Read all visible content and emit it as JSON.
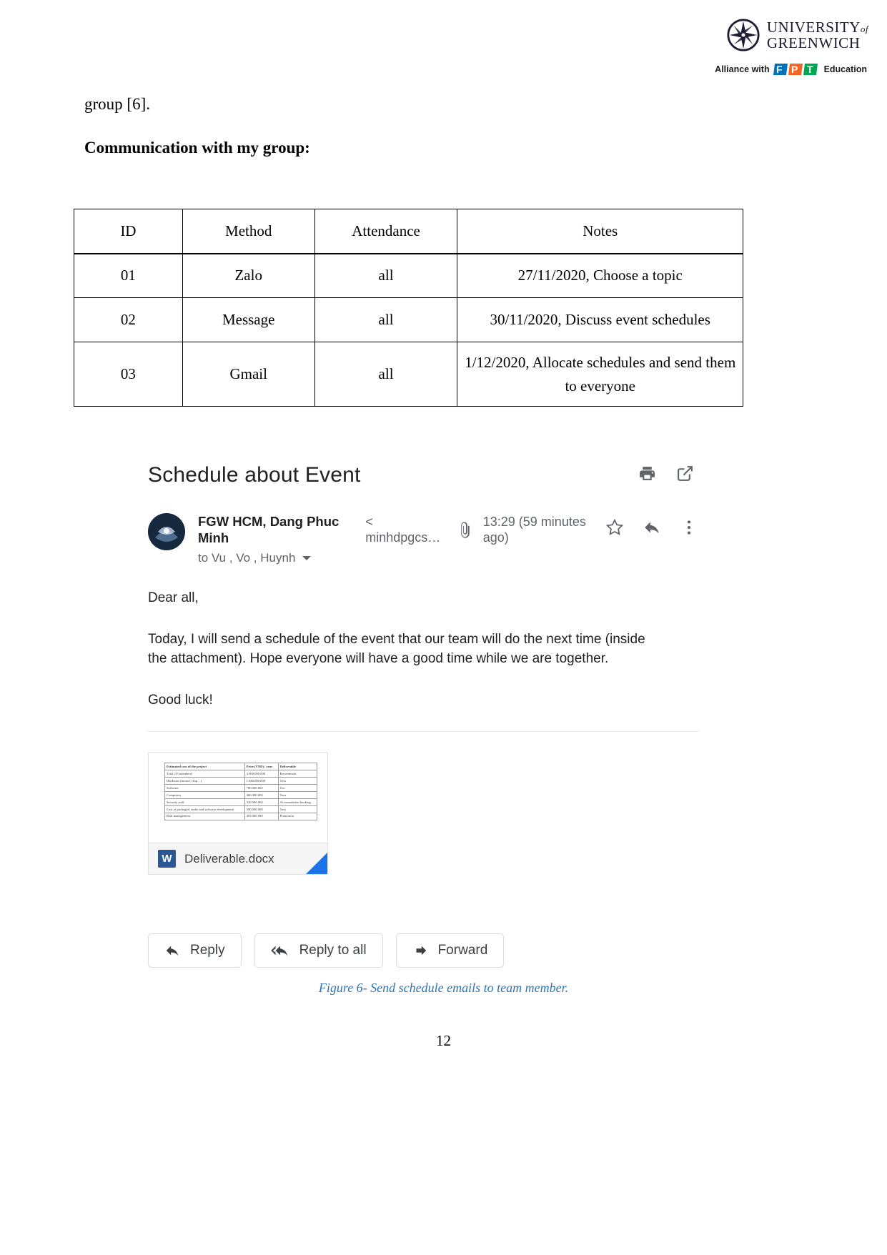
{
  "header": {
    "university_line1": "UNIVERSITY",
    "university_of": "of",
    "university_line2": "GREENWICH",
    "alliance_text": "Alliance with",
    "fpt_suffix": "Education",
    "fpt_colors": [
      "#0072BC",
      "#F26522",
      "#00A651"
    ]
  },
  "document": {
    "continued_line": "group [6].",
    "section_heading": "Communication with my group:",
    "page_number": "12",
    "figure_caption": "Figure 6- Send schedule emails to team member."
  },
  "table": {
    "columns": [
      "ID",
      "Method",
      "Attendance",
      "Notes"
    ],
    "rows": [
      {
        "id": "01",
        "method": "Zalo",
        "attendance": "all",
        "notes": "27/11/2020, Choose a topic"
      },
      {
        "id": "02",
        "method": "Message",
        "attendance": "all",
        "notes": "30/11/2020, Discuss event schedules"
      },
      {
        "id": "03",
        "method": "Gmail",
        "attendance": "all",
        "notes": "1/12/2020, Allocate schedules and send them to everyone"
      }
    ]
  },
  "email": {
    "subject": "Schedule about Event",
    "print_icon": "print-icon",
    "popout_icon": "open-in-new-window-icon",
    "sender_name": "FGW HCM, Dang Phuc Minh",
    "sender_email": "< minhdpgcs…",
    "attachment_icon": "paperclip-icon",
    "timestamp": "13:29 (59 minutes ago)",
    "star_icon": "star-icon",
    "reply_arrow_icon": "reply-arrow-icon",
    "more_icon": "more-vertical-icon",
    "recipients": "to Vu , Vo , Huynh",
    "recipients_caret": "chevron-down-icon",
    "body": [
      "Dear all,",
      "Today, I will send a schedule of the event that our team will do the next time (inside the attachment). Hope everyone will have a good time while we are together.",
      "Good luck!"
    ],
    "attachment": {
      "filename": "Deliverable.docx",
      "file_type_badge": "W",
      "preview_headers": [
        "Estimated cost of the project",
        "Price (VND) / year",
        "Deliverable"
      ],
      "preview_rows": [
        [
          "Total (25 members)",
          "4.900.000.000",
          "Recruitment"
        ],
        [
          "Hardware (mouse, chip…)",
          "1.040.000.000",
          "Tour"
        ],
        [
          "Software",
          "700.000.000",
          "Tea"
        ],
        [
          "Computers",
          "460.000.000",
          "Tour"
        ],
        [
          "Security staff",
          "320.000.000",
          "Accomodation booking"
        ],
        [
          "Cost of packaged, audio and software development",
          "580.000.000",
          "Tour"
        ],
        [
          "Risk management",
          "403.000.000",
          "Promotion"
        ]
      ]
    },
    "actions": [
      {
        "label": "Reply",
        "icon": "reply-icon"
      },
      {
        "label": "Reply to all",
        "icon": "reply-all-icon"
      },
      {
        "label": "Forward",
        "icon": "forward-icon"
      }
    ]
  }
}
